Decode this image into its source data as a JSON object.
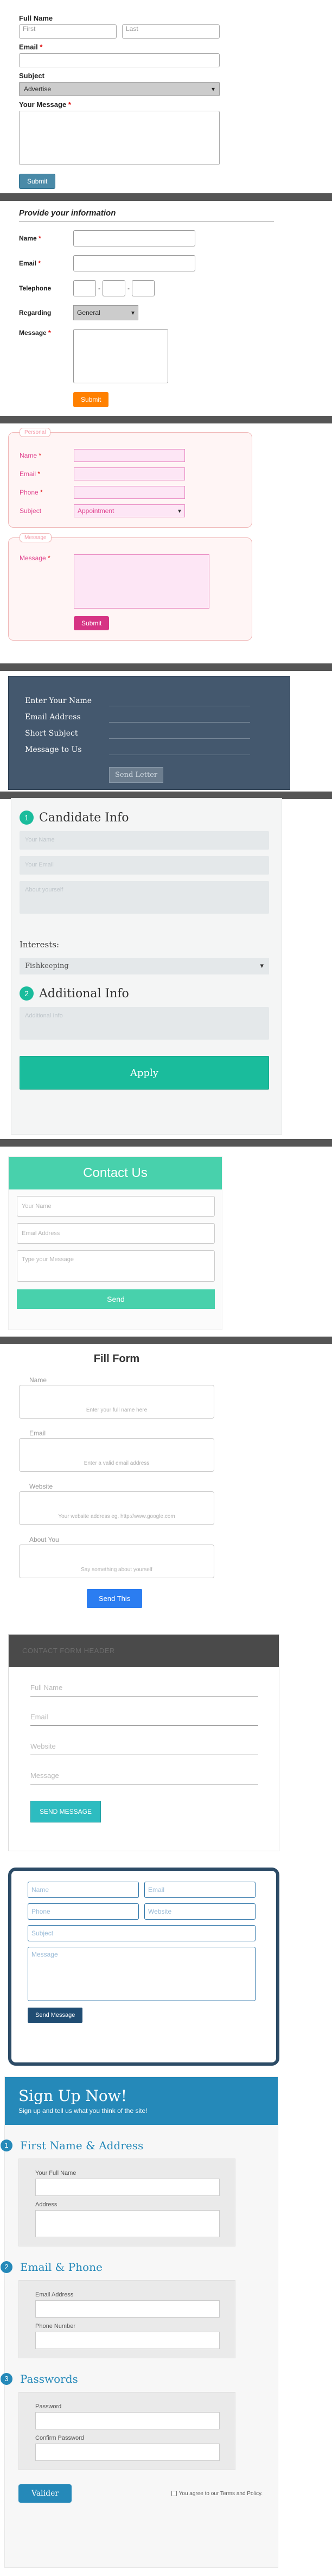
{
  "form1": {
    "full_name_label": "Full Name",
    "first_placeholder": "First",
    "last_placeholder": "Last",
    "email_label": "Email",
    "subject_label": "Subject",
    "subject_value": "Advertise",
    "message_label": "Your Message",
    "required": "*",
    "submit_label": "Submit"
  },
  "form2": {
    "title": "Provide your information",
    "name_label": "Name",
    "email_label": "Email",
    "telephone_label": "Telephone",
    "regarding_label": "Regarding",
    "regarding_value": "General",
    "message_label": "Message",
    "dash": "-",
    "required": "*",
    "submit_label": "Submit"
  },
  "form3": {
    "personal_legend": "Personal",
    "name_label": "Name",
    "email_label": "Email",
    "phone_label": "Phone",
    "subject_label": "Subject",
    "subject_value": "Appointment",
    "message_legend": "Message",
    "message_label": "Message",
    "required": "*",
    "submit_label": "Submit"
  },
  "form4": {
    "name_label": "Enter Your Name",
    "email_label": "Email Address",
    "subject_label": "Short Subject",
    "message_label": "Message to Us",
    "send_label": "Send Letter"
  },
  "form5": {
    "step1_num": "1",
    "step1_title": "Candidate Info",
    "name_placeholder": "Your Name",
    "email_placeholder": "Your Email",
    "about_placeholder": "About yourself",
    "interests_label": "Interests:",
    "interests_value": "Fishkeeping",
    "step2_num": "2",
    "step2_title": "Additional Info",
    "additional_placeholder": "Additional Info",
    "apply_label": "Apply"
  },
  "form6": {
    "title": "Contact Us",
    "name_placeholder": "Your Name",
    "email_placeholder": "Email Address",
    "message_placeholder": "Type your Message",
    "send_label": "Send"
  },
  "form7": {
    "title": "Fill Form",
    "name_label": "Name",
    "name_hint": "Enter your full name here",
    "email_label": "Email",
    "email_hint": "Enter a valid email address",
    "website_label": "Website",
    "website_hint": "Your website address eg. http://www.google.com",
    "about_label": "About You",
    "about_hint": "Say something about yourself",
    "send_label": "Send This"
  },
  "form8": {
    "title": "CONTACT FORM HEADER",
    "fullname_placeholder": "Full Name",
    "email_placeholder": "Email",
    "website_placeholder": "Website",
    "message_placeholder": "Message",
    "send_label": "SEND MESSAGE"
  },
  "form9": {
    "name_placeholder": "Name",
    "email_placeholder": "Email",
    "phone_placeholder": "Phone",
    "website_placeholder": "Website",
    "subject_placeholder": "Subject",
    "message_placeholder": "Message",
    "send_label": "Send Message"
  },
  "form10": {
    "title": "Sign Up Now!",
    "subtitle": "Sign up and tell us what you think of the site!",
    "step1_num": "1",
    "step1_title": "First Name & Address",
    "fullname_label": "Your Full Name",
    "address_label": "Address",
    "step2_num": "2",
    "step2_title": "Email & Phone",
    "email_label": "Email Address",
    "phone_label": "Phone Number",
    "step3_num": "3",
    "step3_title": "Passwords",
    "password_label": "Password",
    "confirm_label": "Confirm Password",
    "submit_label": "Valider",
    "terms_label": "You agree to our Terms and Policy."
  }
}
